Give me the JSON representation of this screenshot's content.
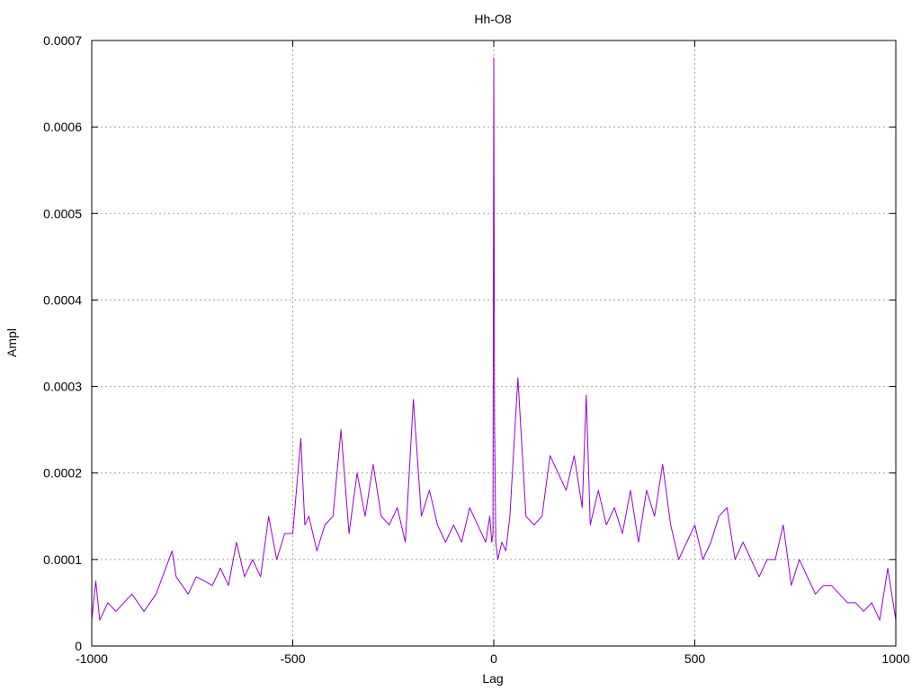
{
  "chart_data": {
    "type": "line",
    "title": "Hh-O8",
    "xlabel": "Lag",
    "ylabel": "Ampl",
    "xlim": [
      -1000,
      1000
    ],
    "ylim": [
      0,
      0.0007
    ],
    "x_ticks": [
      -1000,
      -500,
      0,
      500,
      1000
    ],
    "x_tick_labels": [
      "-1000",
      "-500",
      "0",
      "500",
      "1000"
    ],
    "y_ticks": [
      0,
      0.0001,
      0.0002,
      0.0003,
      0.0004,
      0.0005,
      0.0006,
      0.0007
    ],
    "y_tick_labels": [
      "0",
      "0.0001",
      "0.0002",
      "0.0003",
      "0.0004",
      "0.0005",
      "0.0006",
      "0.0007"
    ],
    "grid": true,
    "series": [
      {
        "color": "#9400d3",
        "x": [
          -1000,
          -990,
          -980,
          -960,
          -940,
          -920,
          -900,
          -870,
          -840,
          -800,
          -790,
          -760,
          -740,
          -700,
          -680,
          -660,
          -640,
          -620,
          -600,
          -580,
          -560,
          -540,
          -520,
          -500,
          -480,
          -470,
          -460,
          -440,
          -420,
          -400,
          -380,
          -360,
          -340,
          -320,
          -300,
          -280,
          -260,
          -240,
          -220,
          -200,
          -180,
          -160,
          -140,
          -120,
          -100,
          -80,
          -60,
          -40,
          -20,
          -10,
          -5,
          -2,
          0,
          2,
          5,
          10,
          20,
          30,
          40,
          60,
          80,
          100,
          120,
          140,
          160,
          180,
          200,
          220,
          230,
          240,
          260,
          280,
          300,
          320,
          340,
          360,
          380,
          400,
          420,
          440,
          460,
          480,
          500,
          520,
          540,
          560,
          580,
          600,
          620,
          640,
          660,
          680,
          700,
          720,
          740,
          760,
          780,
          800,
          820,
          840,
          860,
          880,
          900,
          920,
          940,
          960,
          980,
          1000
        ],
        "y": [
          3e-05,
          7.5e-05,
          3e-05,
          5e-05,
          4e-05,
          5e-05,
          6e-05,
          4e-05,
          6e-05,
          0.00011,
          8e-05,
          6e-05,
          8e-05,
          7e-05,
          9e-05,
          7e-05,
          0.00012,
          8e-05,
          0.0001,
          8e-05,
          0.00015,
          0.0001,
          0.00013,
          0.00013,
          0.00024,
          0.00014,
          0.00015,
          0.00011,
          0.00014,
          0.00015,
          0.00025,
          0.00013,
          0.0002,
          0.00015,
          0.00021,
          0.00015,
          0.00014,
          0.00016,
          0.00012,
          0.000285,
          0.00015,
          0.00018,
          0.00014,
          0.00012,
          0.00014,
          0.00012,
          0.00016,
          0.00014,
          0.00012,
          0.00015,
          0.00012,
          0.00013,
          0.00068,
          0.00026,
          0.00012,
          0.0001,
          0.00012,
          0.00011,
          0.00015,
          0.00031,
          0.00015,
          0.00014,
          0.00015,
          0.00022,
          0.0002,
          0.00018,
          0.00022,
          0.00016,
          0.00029,
          0.00014,
          0.00018,
          0.00014,
          0.00016,
          0.00013,
          0.00018,
          0.00012,
          0.00018,
          0.00015,
          0.00021,
          0.00014,
          0.0001,
          0.00012,
          0.00014,
          0.0001,
          0.00012,
          0.00015,
          0.00016,
          0.0001,
          0.00012,
          0.0001,
          8e-05,
          0.0001,
          0.0001,
          0.00014,
          7e-05,
          0.0001,
          8e-05,
          6e-05,
          7e-05,
          7e-05,
          6e-05,
          5e-05,
          5e-05,
          4e-05,
          5e-05,
          3e-05,
          9e-05,
          3e-05
        ]
      }
    ]
  }
}
